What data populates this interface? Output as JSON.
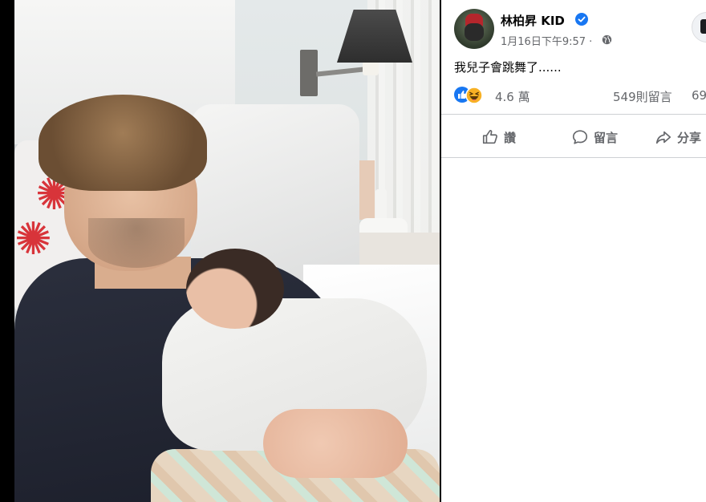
{
  "post": {
    "author": "林柏昇 KID",
    "timestamp": "1月16日下午9:57",
    "separator": "·",
    "caption": "我兒子會跳舞了......",
    "reactions_count": "4.6 萬",
    "comments_count": "549則留言",
    "shares_count": "69",
    "actions": {
      "like": "讚",
      "comment": "留言",
      "share": "分享"
    }
  },
  "icons": {
    "verified": "verified-badge-icon",
    "audience": "globe-icon",
    "reaction_like": "like-reaction-icon",
    "reaction_haha": "haha-reaction-icon",
    "like_action": "thumbs-up-icon",
    "comment_action": "speech-bubble-icon",
    "share_action": "share-arrow-icon"
  },
  "colors": {
    "brand_blue": "#1877f2",
    "secondary_text": "#65676b",
    "primary_text": "#050505",
    "haha_yellow": "#f7b125"
  }
}
